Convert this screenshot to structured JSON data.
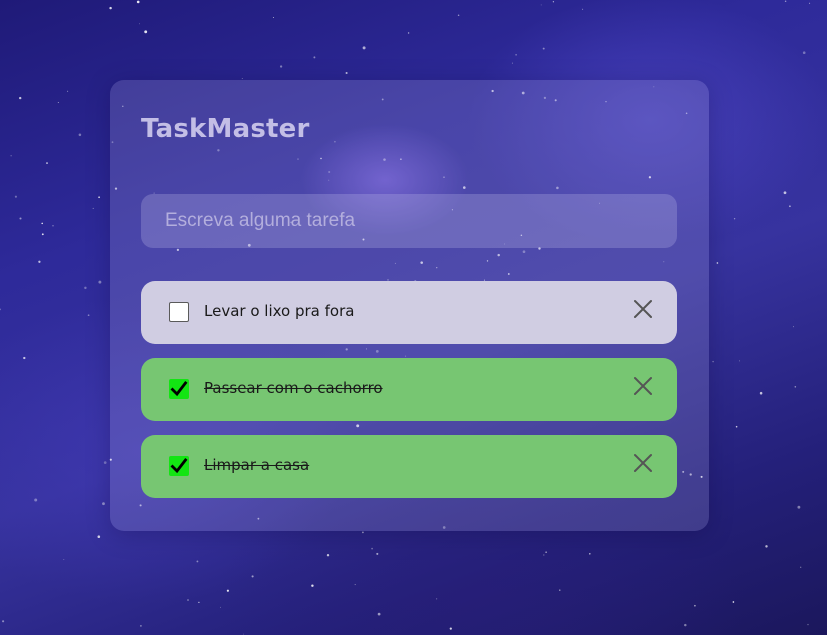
{
  "app": {
    "title": "TaskMaster"
  },
  "new_task": {
    "placeholder": "Escreva alguma tarefa",
    "value": ""
  },
  "tasks": [
    {
      "label": "Levar o lixo pra fora",
      "done": false
    },
    {
      "label": "Passear com o cachorro",
      "done": true
    },
    {
      "label": "Limpar a casa",
      "done": true
    }
  ],
  "icons": {
    "check": "check-icon",
    "delete": "close-icon"
  },
  "colors": {
    "pending_task_bg": "#d0cde2",
    "done_task_bg": "#77c672",
    "checkbox_checked": "#13e513",
    "title": "#c3bee6"
  }
}
